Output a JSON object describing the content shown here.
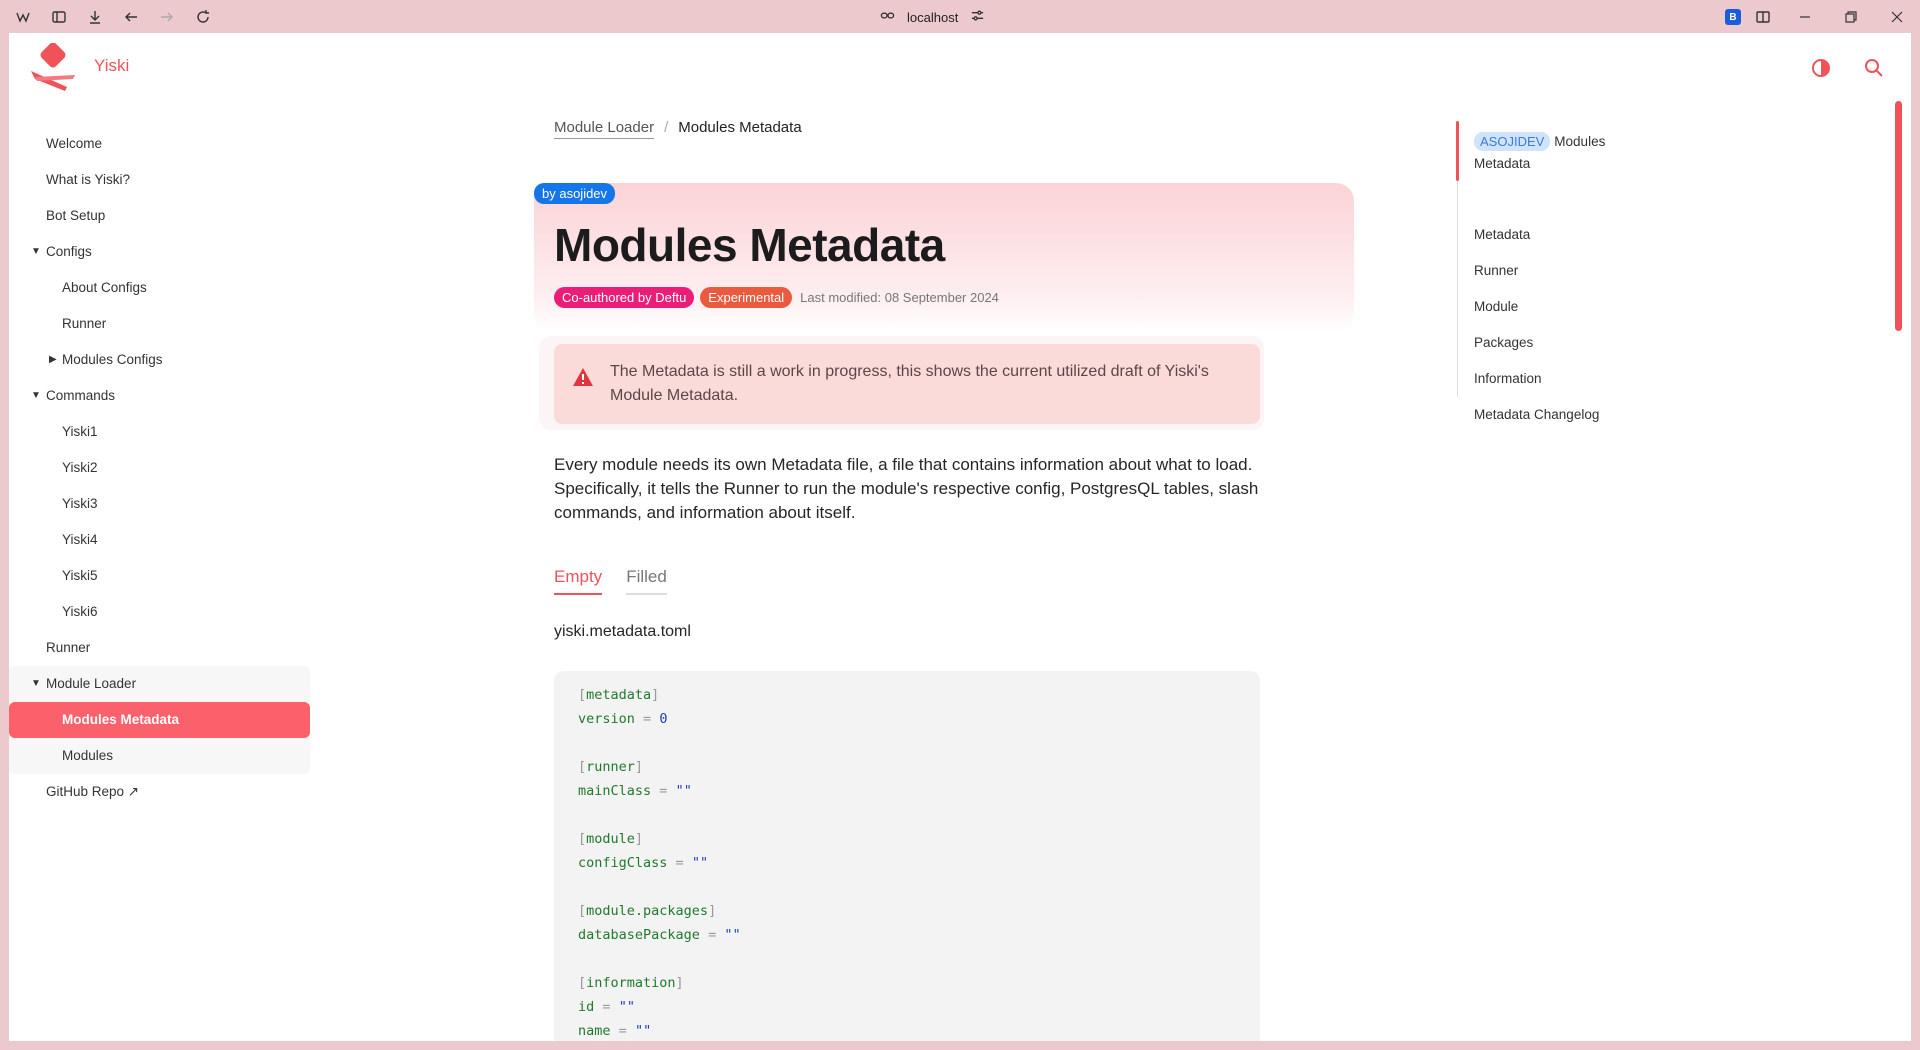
{
  "browser": {
    "url": "localhost",
    "bitwarden": "B"
  },
  "site": {
    "name": "Yiski"
  },
  "sidebar": {
    "items": [
      {
        "label": "Welcome"
      },
      {
        "label": "What is Yiski?"
      },
      {
        "label": "Bot Setup"
      },
      {
        "label": "Configs"
      },
      {
        "label": "About Configs"
      },
      {
        "label": "Runner"
      },
      {
        "label": "Modules Configs"
      },
      {
        "label": "Commands"
      },
      {
        "label": "Yiski1"
      },
      {
        "label": "Yiski2"
      },
      {
        "label": "Yiski3"
      },
      {
        "label": "Yiski4"
      },
      {
        "label": "Yiski5"
      },
      {
        "label": "Yiski6"
      },
      {
        "label": "Runner"
      },
      {
        "label": "Module Loader"
      },
      {
        "label": "Modules Metadata"
      },
      {
        "label": "Modules"
      },
      {
        "label": "GitHub Repo ↗"
      }
    ]
  },
  "breadcrumb": {
    "parent": "Module Loader",
    "sep": "/",
    "current": "Modules Metadata"
  },
  "article": {
    "author_pill": "by asojidev",
    "title": "Modules Metadata",
    "badge_coauthor": "Co-authored by Deftu",
    "badge_status": "Experimental",
    "modified": "Last modified: 08 September 2024",
    "callout": "The Metadata is still a work in progress, this shows the current utilized draft of Yiski's Module Metadata.",
    "paragraph": "Every module needs its own Metadata file, a file that contains information about what to load. Specifically, it tells the Runner to run the module's respective config, PostgresQL tables, slash commands, and information about itself.",
    "tabs": [
      {
        "label": "Empty"
      },
      {
        "label": "Filled"
      }
    ],
    "filename": "yiski.metadata.toml",
    "code": {
      "s1": "metadata",
      "k1": "version",
      "v1": "0",
      "s2": "runner",
      "k2": "mainClass",
      "v2": "\"\"",
      "s3": "module",
      "k3": "configClass",
      "v3": "\"\"",
      "s4": "module.packages",
      "k4": "databasePackage",
      "v4": "\"\"",
      "s5": "information",
      "k5": "id",
      "v5": "\"\"",
      "k6": "name",
      "v6": "\"\"",
      "lb": "[",
      "rb": "]",
      "eq": "="
    }
  },
  "toc": {
    "tag": "ASOJIDEV",
    "first_line1": "Modules",
    "first_line2": "Metadata",
    "items": [
      "Metadata",
      "Runner",
      "Module",
      "Packages",
      "Information",
      "Metadata Changelog"
    ]
  }
}
